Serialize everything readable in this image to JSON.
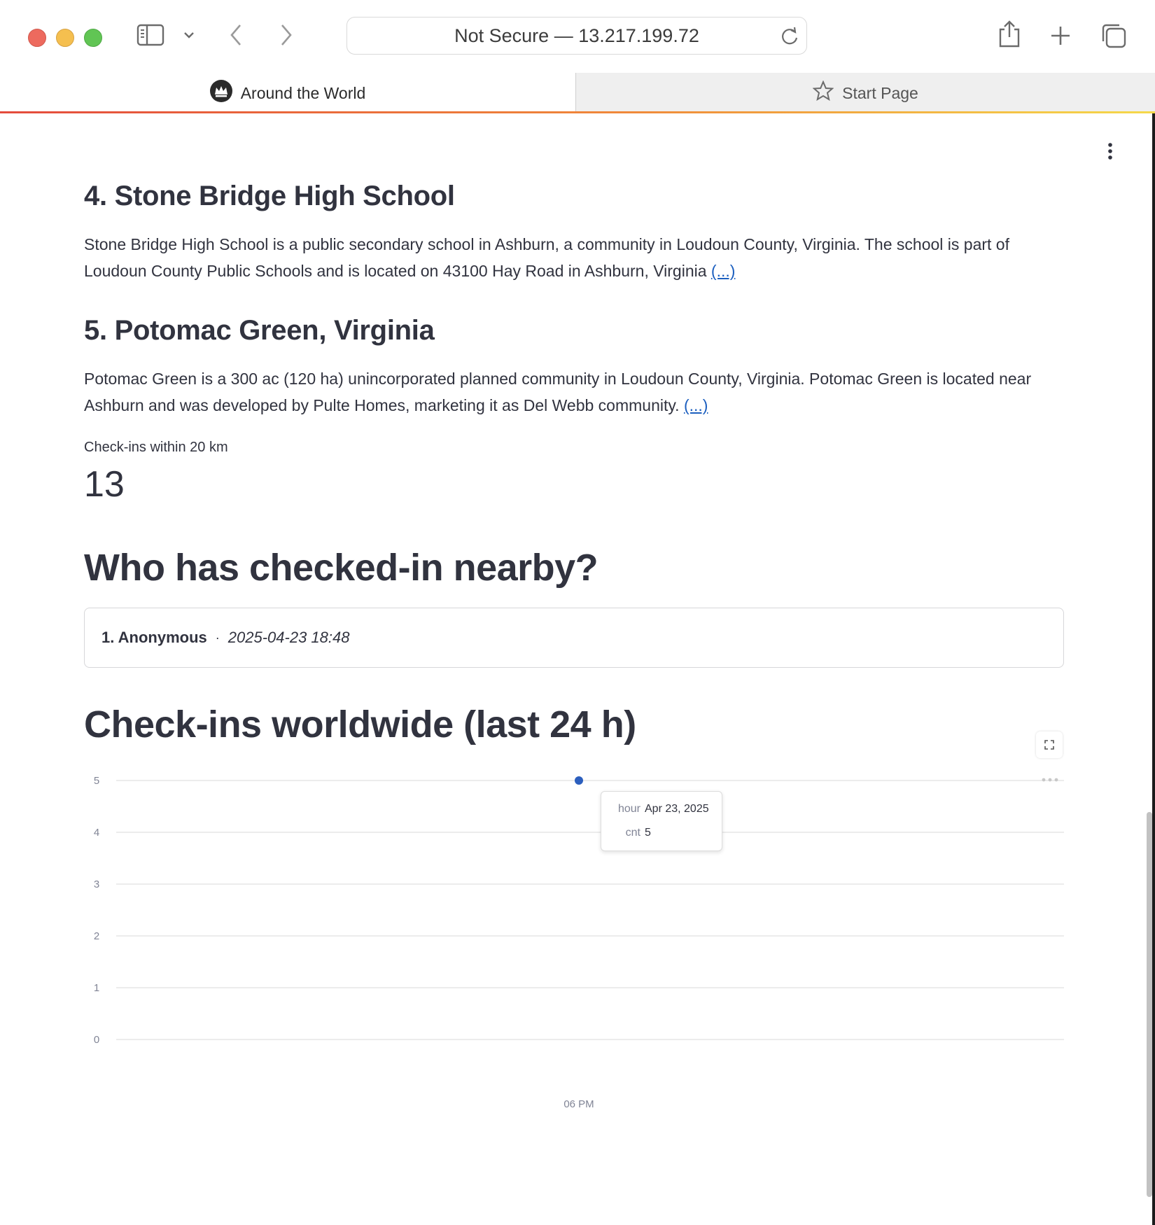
{
  "browser": {
    "url": "Not Secure — 13.217.199.72",
    "tabs": [
      {
        "label": "Around the World",
        "icon": "crown-icon",
        "active": true
      },
      {
        "label": "Start Page",
        "icon": "star-icon",
        "active": false
      }
    ],
    "tab_accent_colors": [
      "#e44b3c",
      "#f08a3a",
      "#f5d94a"
    ]
  },
  "page": {
    "sections": [
      {
        "title": "4. Stone Bridge High School",
        "text": "Stone Bridge High School is a public secondary school in Ashburn, a community in Loudoun County, Virginia. The school is part of Loudoun County Public Schools and is located on 43100 Hay Road in Ashburn, Virginia",
        "more_link": "(...)"
      },
      {
        "title": "5. Potomac Green, Virginia",
        "text": "Potomac Green is a 300 ac (120 ha) unincorporated planned community in Loudoun County, Virginia. Potomac Green is located near Ashburn and was developed by Pulte Homes, marketing it as Del Webb community.",
        "more_link": "(...)"
      }
    ],
    "metric": {
      "label": "Check-ins within 20 km",
      "value": "13"
    },
    "nearby": {
      "heading": "Who has checked-in nearby?",
      "items": [
        {
          "name": "1. Anonymous",
          "separator": "·",
          "time": "2025-04-23 18:48"
        }
      ]
    },
    "worldwide": {
      "heading": "Check-ins worldwide (last 24 h)"
    }
  },
  "tooltip": {
    "rows": [
      {
        "key": "hour",
        "value": "Apr 23, 2025"
      },
      {
        "key": "cnt",
        "value": "5"
      }
    ]
  },
  "chart_data": {
    "type": "scatter",
    "title": "",
    "xlabel": "",
    "ylabel": "",
    "x_ticks": [
      "06 PM"
    ],
    "y_ticks": [
      0,
      1,
      2,
      3,
      4,
      5
    ],
    "ylim": [
      0,
      5
    ],
    "grid": true,
    "point_color": "#2c5fbe",
    "series": [
      {
        "x": [
          "06 PM"
        ],
        "y": [
          5
        ]
      }
    ]
  }
}
